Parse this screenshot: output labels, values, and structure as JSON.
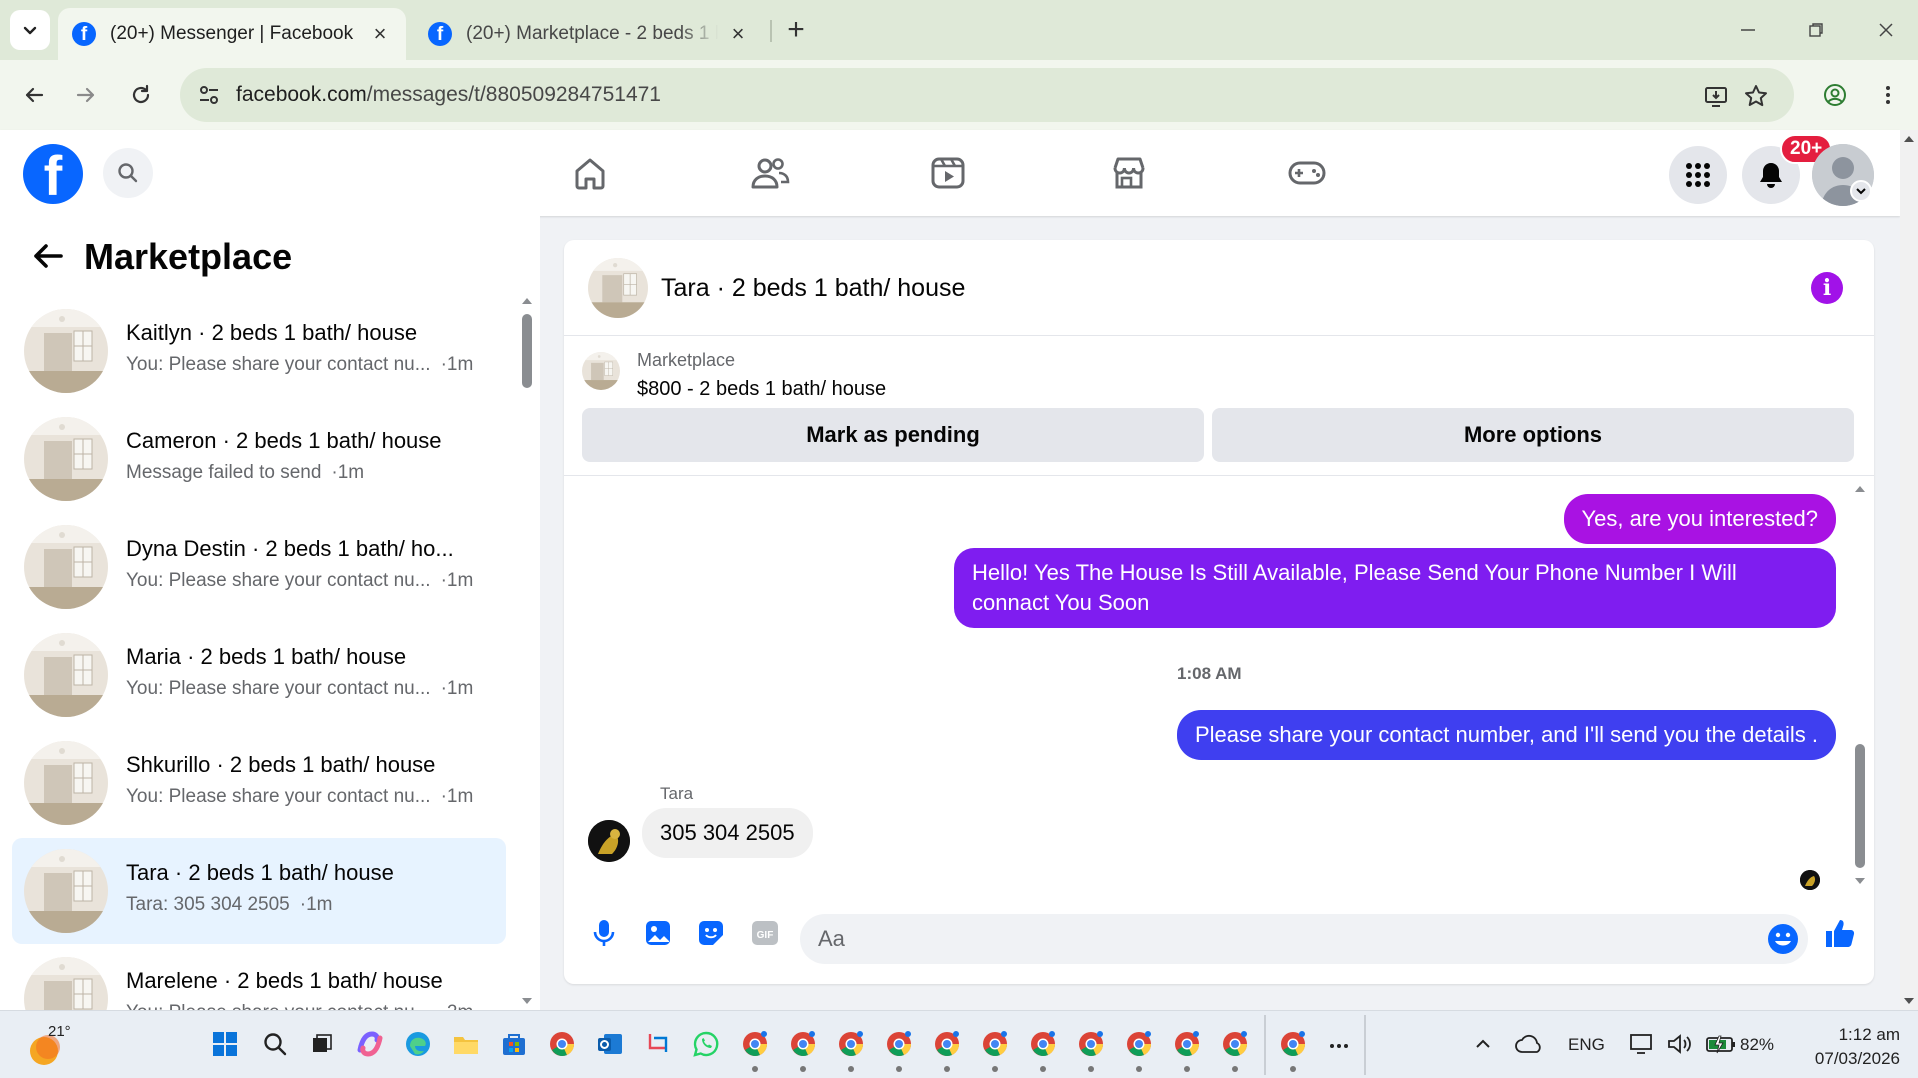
{
  "browser": {
    "tabs": [
      {
        "title": "(20+) Messenger | Facebook",
        "active": true
      },
      {
        "title": "(20+) Marketplace - 2 beds 1 bath",
        "active": false
      }
    ],
    "url_host": "facebook.com",
    "url_path": "/messages/t/880509284751471"
  },
  "fb_header": {
    "notification_badge": "20+",
    "nav_icons": [
      "home-icon",
      "friends-icon",
      "video-icon",
      "marketplace-icon",
      "gaming-icon"
    ]
  },
  "left_panel": {
    "title": "Marketplace",
    "conversations": [
      {
        "title": "Kaitlyn · 2 beds 1 bath/ house",
        "preview": "You: Please share your contact nu...",
        "time": "·1m",
        "selected": false
      },
      {
        "title": "Cameron · 2 beds 1 bath/ house",
        "preview": "Message failed to send",
        "time": "·1m",
        "selected": false
      },
      {
        "title": "Dyna Destin · 2 beds 1 bath/ ho...",
        "preview": "You: Please share your contact nu...",
        "time": "·1m",
        "selected": false
      },
      {
        "title": "Maria · 2 beds 1 bath/ house",
        "preview": "You: Please share your contact nu...",
        "time": "·1m",
        "selected": false
      },
      {
        "title": "Shkurillo · 2 beds 1 bath/ house",
        "preview": "You: Please share your contact nu...",
        "time": "·1m",
        "selected": false
      },
      {
        "title": "Tara · 2 beds 1 bath/ house",
        "preview": "Tara: 305 304 2505",
        "time": "·1m",
        "selected": true
      },
      {
        "title": "Marelene · 2 beds 1 bath/ house",
        "preview": "You: Please share your contact nu...",
        "time": "·2m",
        "selected": false
      }
    ]
  },
  "chat": {
    "title": "Tara · 2 beds 1 bath/ house",
    "listing": {
      "label": "Marketplace",
      "title": "$800 - 2 beds 1 bath/ house",
      "mark_pending": "Mark as pending",
      "more_options": "More options"
    },
    "messages": [
      {
        "from": "me",
        "text": "Yes, are you interested?"
      },
      {
        "from": "me",
        "text": "Hello! Yes The House  Is Still Available, Please Send Your Phone Number I Will connact You Soon"
      },
      {
        "from": "me",
        "text": "Please share your contact number, and I'll send you the details ."
      },
      {
        "from": "Tara",
        "text": "305 304 2505"
      }
    ],
    "timestamp": "1:08 AM",
    "sender_name": "Tara",
    "composer_placeholder": "Aa",
    "bubble_colors": [
      "#a912e3",
      "#7f1df0",
      "#3f3ff0"
    ]
  },
  "taskbar": {
    "temperature": "21°",
    "language": "ENG",
    "battery": "82%",
    "time": "1:12 am",
    "date": "07/03/2026"
  }
}
